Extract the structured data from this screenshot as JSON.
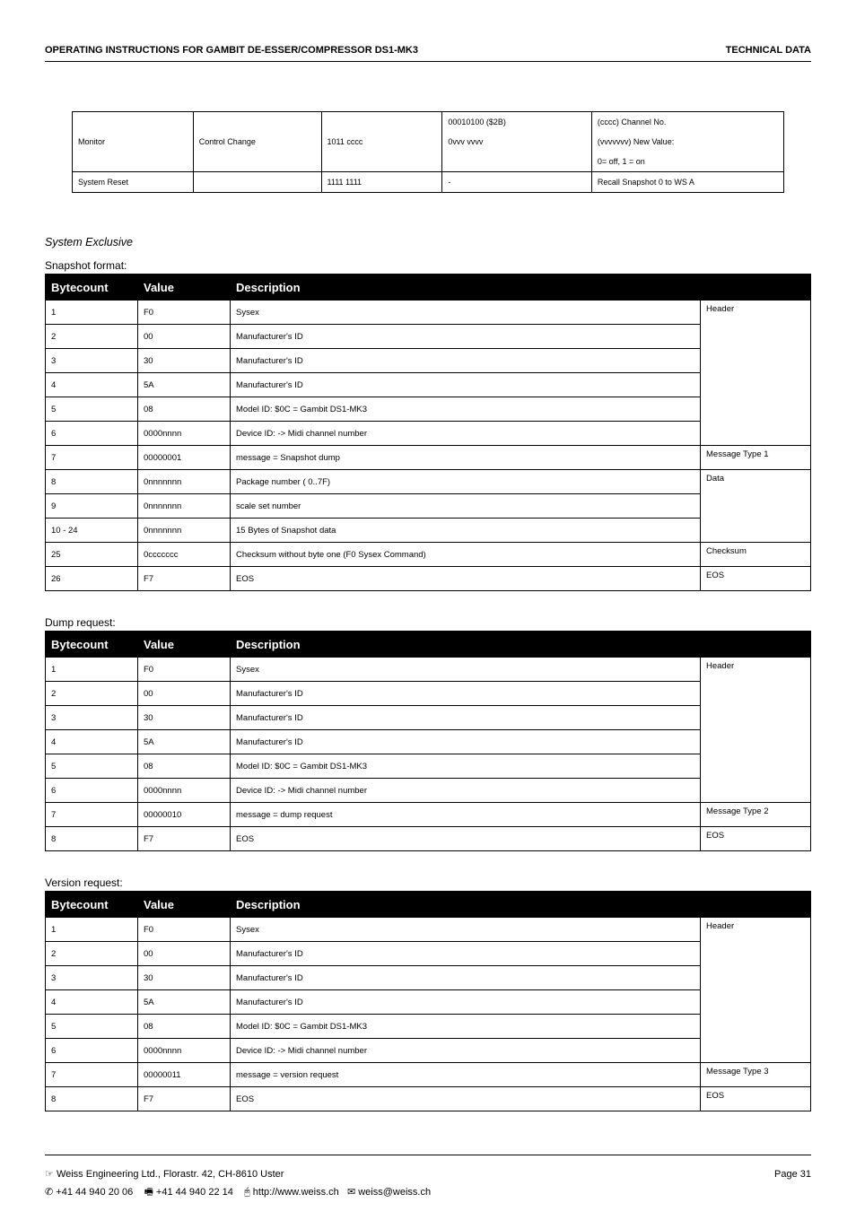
{
  "header": {
    "left": "OPERATING  INSTRUCTIONS  FOR  GAMBIT  DE-ESSER/COMPRESSOR DS1-MK3",
    "right": "TECHNICAL DATA"
  },
  "top_table": {
    "rows": [
      {
        "c0": "Monitor",
        "c1": "Control Change",
        "c2": "1011 cccc",
        "c3a": "00010100 ($2B)",
        "c3b": "0vvv vvvv",
        "c4a": "(cccc) Channel No.",
        "c4b": "(vvvvvvv) New Value:",
        "c4c": "0= off, 1 = on"
      },
      {
        "c0": "System Reset",
        "c1": "",
        "c2": "1111 1111",
        "c3": "-",
        "c4": "Recall Snapshot 0 to WS A"
      }
    ]
  },
  "system_exclusive": "System Exclusive",
  "snapshot": {
    "label": "Snapshot format:",
    "headers": {
      "bc": "Bytecount",
      "val": "Value",
      "desc": "Description"
    },
    "groups": [
      {
        "note": "Header",
        "rows": [
          {
            "bc": "1",
            "val": "F0",
            "desc": "Sysex"
          },
          {
            "bc": "2",
            "val": "00",
            "desc": "Manufacturer's ID"
          },
          {
            "bc": "3",
            "val": "30",
            "desc": "Manufacturer's ID"
          },
          {
            "bc": "4",
            "val": "5A",
            "desc": "Manufacturer's ID"
          },
          {
            "bc": "5",
            "val": "08",
            "desc": "Model  ID: $0C = Gambit DS1-MK3"
          },
          {
            "bc": "6",
            "val": "0000nnnn",
            "desc": "Device ID: -> Midi channel number"
          }
        ]
      },
      {
        "note": "Message Type 1",
        "rows": [
          {
            "bc": "7",
            "val": "00000001",
            "desc": "message = Snapshot dump"
          }
        ]
      },
      {
        "note": "Data",
        "rows": [
          {
            "bc": "8",
            "val": "0nnnnnnn",
            "desc": "Package number   ( 0..7F)"
          },
          {
            "bc": "9",
            "val": "0nnnnnnn",
            "desc": "scale set number"
          },
          {
            "bc": "10 - 24",
            "val": "0nnnnnnn",
            "desc": "15 Bytes of Snapshot data"
          }
        ]
      },
      {
        "note": "Checksum",
        "rows": [
          {
            "bc": "25",
            "val": "0ccccccc",
            "desc": "Checksum without byte one (F0 Sysex Command)"
          }
        ]
      },
      {
        "note": "EOS",
        "rows": [
          {
            "bc": "26",
            "val": "F7",
            "desc": "EOS"
          }
        ]
      }
    ]
  },
  "dump": {
    "label": "Dump request:",
    "headers": {
      "bc": "Bytecount",
      "val": "Value",
      "desc": "Description"
    },
    "groups": [
      {
        "note": "Header",
        "rows": [
          {
            "bc": "1",
            "val": "F0",
            "desc": "Sysex"
          },
          {
            "bc": "2",
            "val": "00",
            "desc": "Manufacturer's ID"
          },
          {
            "bc": "3",
            "val": "30",
            "desc": "Manufacturer's ID"
          },
          {
            "bc": "4",
            "val": "5A",
            "desc": "Manufacturer's ID"
          },
          {
            "bc": "5",
            "val": "08",
            "desc": "Model  ID: $0C = Gambit DS1-MK3"
          },
          {
            "bc": "6",
            "val": "0000nnnn",
            "desc": "Device ID: -> Midi channel number"
          }
        ]
      },
      {
        "note": "Message Type 2",
        "rows": [
          {
            "bc": "7",
            "val": "00000010",
            "desc": "message = dump request"
          }
        ]
      },
      {
        "note": "EOS",
        "rows": [
          {
            "bc": "8",
            "val": "F7",
            "desc": "EOS"
          }
        ]
      }
    ]
  },
  "version": {
    "label": "Version  request:",
    "headers": {
      "bc": "Bytecount",
      "val": "Value",
      "desc": "Description"
    },
    "groups": [
      {
        "note": "Header",
        "rows": [
          {
            "bc": "1",
            "val": "F0",
            "desc": "Sysex"
          },
          {
            "bc": "2",
            "val": "00",
            "desc": "Manufacturer's ID"
          },
          {
            "bc": "3",
            "val": "30",
            "desc": "Manufacturer's ID"
          },
          {
            "bc": "4",
            "val": "5A",
            "desc": "Manufacturer's ID"
          },
          {
            "bc": "5",
            "val": "08",
            "desc": "Model  ID: $0C = Gambit DS1-MK3"
          },
          {
            "bc": "6",
            "val": "0000nnnn",
            "desc": "Device ID: -> Midi channel number"
          }
        ]
      },
      {
        "note": "Message Type 3",
        "rows": [
          {
            "bc": "7",
            "val": "00000011",
            "desc": "message = version request"
          }
        ]
      },
      {
        "note": "EOS",
        "rows": [
          {
            "bc": "8",
            "val": "F7",
            "desc": "EOS"
          }
        ]
      }
    ]
  },
  "footer": {
    "line1_left_prefix": "Weiss Engineering Ltd., Florastr. 42, CH-8610 Uster",
    "line1_right": "Page  31",
    "line2": "+41 44 940 20 06      +41 44 940 22 14      http://www.weiss.ch    weiss@weiss.ch",
    "phone": "+41 44 940 20 06",
    "fax": "+41 44 940 22 14",
    "url": "http://www.weiss.ch",
    "email": "weiss@weiss.ch"
  }
}
